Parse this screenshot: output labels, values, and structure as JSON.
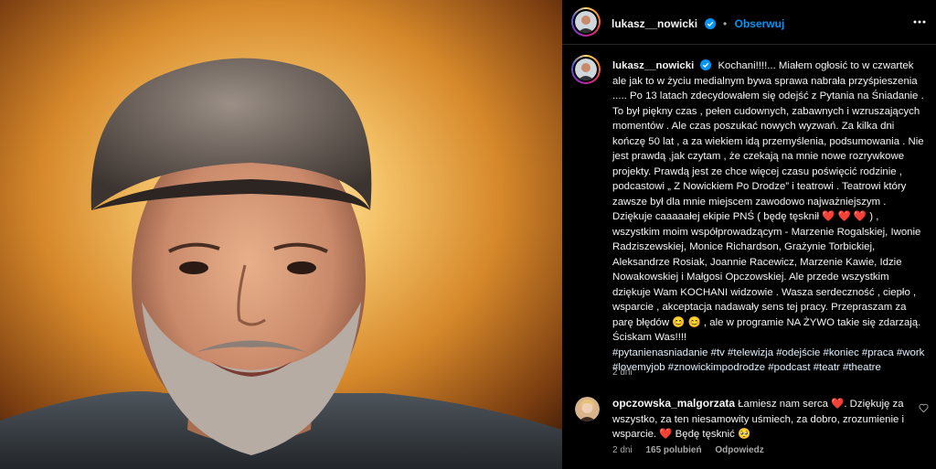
{
  "post": {
    "author": "lukasz__nowicki",
    "follow_label": "Obserwuj",
    "dot": "•",
    "caption_text": "Kochani!!!!... Miałem ogłosić to w czwartek ale jak to w życiu medialnym bywa sprawa nabrała przyśpieszenia ..... Po 13 latach zdecydowałem się odejść z Pytania na Śniadanie . To był piękny czas , pełen cudownych, zabawnych i wzruszających momentów . Ale czas poszukać nowych wyzwań. Za kilka dni kończę 50 lat , a za wiekiem idą przemyślenia, podsumowania . Nie jest prawdą ,jak czytam , że czekają na mnie nowe rozrywkowe projekty. Prawdą jest ze chce więcej czasu poświęcić rodzinie , podcastowi „ Z Nowickiem Po Drodze” i teatrowi . Teatrowi który zawsze był dla mnie miejscem zawodowo najważniejszym . Dziękuje caaaaałej ekipie PNŚ ( będę tęsknił ❤️ ❤️ ❤️ ) , wszystkim moim współprowadzącym - Marzenie Rogalskiej, Iwonie Radziszewskiej, Monice Richardson, Grażynie Torbickiej, Aleksandrze Rosiak, Joannie Racewicz, Marzenie Kawie, Idzie Nowakowskiej i Małgosi Opczowskiej. Ale przede wszystkim dziękuje Wam KOCHANI widzowie . Wasza serdeczność , ciepło , wsparcie , akceptacja nadawały sens tej pracy. Przepraszam za parę błędów 😊 😊 , ale w programie NA ŻYWO takie się zdarzają. Ściskam Was!!!!",
    "hashtags": "#pytanienasniadanie #tv #telewizja #odejście #koniec #praca #work #lovemyjob #znowickimpodrodze #podcast #teatr #theatre",
    "time": "2 dni"
  },
  "comment": {
    "author": "opczowska_malgorzata",
    "text_before": "Łamiesz nam serca ",
    "heart1": "❤️",
    "text_middle": ". Dziękuję za wszystko, za ten niesamowity uśmiech, za dobro, zrozumienie i wsparcie. ",
    "heart2": "❤️",
    "text_after": " Będę tęsknić 🥺",
    "time": "2 dni",
    "likes": "165 polubień",
    "reply": "Odpowiedz"
  },
  "icons": {
    "verified": "verified-badge-icon",
    "more": "more-options-icon",
    "like": "heart-outline-icon"
  },
  "colors": {
    "follow": "#0095f6",
    "verified": "#0095f6",
    "muted": "#a8a8a8"
  }
}
